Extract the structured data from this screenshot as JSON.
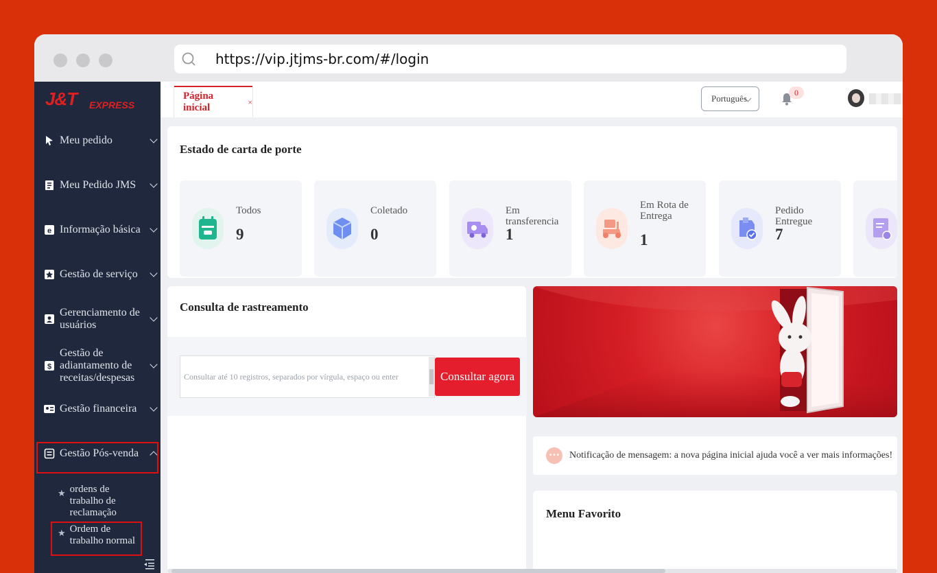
{
  "browser": {
    "url": "https://vip.jtjms-br.com/#/login"
  },
  "sidebar": {
    "logo_main": "J&T",
    "logo_sub": "EXPRESS",
    "items": [
      {
        "label": "Meu pedido",
        "icon": "cursor-icon"
      },
      {
        "label": "Meu Pedido JMS",
        "icon": "receipt-icon"
      },
      {
        "label": "Informação básica",
        "icon": "info-card-icon"
      },
      {
        "label": "Gestão de serviço",
        "icon": "service-star-icon"
      },
      {
        "label": "Gerenciamento de usuários",
        "icon": "user-card-icon"
      },
      {
        "label": "Gestão de adiantamento de receitas/despesas",
        "icon": "finance-card-icon"
      },
      {
        "label": "Gestão financeira",
        "icon": "id-card-icon"
      },
      {
        "label": "Gestão Pós-venda",
        "icon": "after-sales-icon",
        "expanded": true
      }
    ],
    "sub_items": [
      {
        "label": "ordens de trabalho de reclamação"
      },
      {
        "label": "Ordem de trabalho normal"
      }
    ]
  },
  "topbar": {
    "tab_label": "Página inicial",
    "tab_close": "×",
    "language": "Português",
    "notification_count": "0"
  },
  "waybill": {
    "title": "Estado de carta de porte",
    "stats": [
      {
        "label": "Todos",
        "value": "9",
        "color": "#1fb58f"
      },
      {
        "label": "Coletado",
        "value": "0",
        "color": "#6f8ff0"
      },
      {
        "label": "Em transferencia",
        "value": "1",
        "color": "#a98ef2"
      },
      {
        "label": "Em Rota de Entrega",
        "value": "1",
        "color": "#f49a83"
      },
      {
        "label": "Pedido Entregue",
        "value": "7",
        "color": "#7a8ef2"
      },
      {
        "label": "",
        "value": "",
        "color": "#b49ef0"
      }
    ]
  },
  "tracking": {
    "title": "Consulta de rastreamento",
    "placeholder": "Consultar até 10 registros, separados por vírgula, espaço ou enter",
    "button": "Consultar agora"
  },
  "notification": {
    "text": "Notificação de mensagem: a nova página inicial ajuda você a ver mais informações!"
  },
  "favorites": {
    "title": "Menu Favorito"
  },
  "colors": {
    "brand_red": "#e41e2c",
    "sidebar_bg": "#1f283c",
    "page_bg": "#d9300a"
  }
}
